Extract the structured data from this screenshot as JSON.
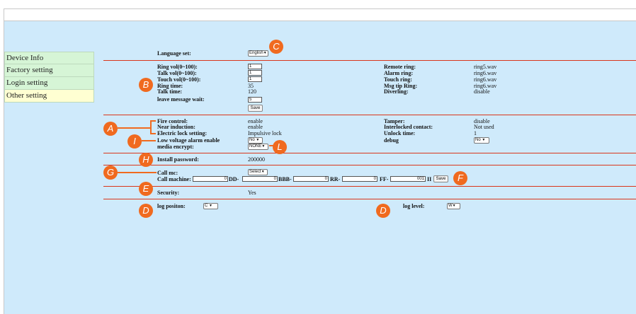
{
  "sidebar": {
    "items": [
      {
        "label": "Device Info"
      },
      {
        "label": "Factory setting"
      },
      {
        "label": "Login setting"
      },
      {
        "label": "Other setting"
      }
    ]
  },
  "language": {
    "label": "Language set:",
    "value": "English"
  },
  "ring": {
    "ring_vol_label": "Ring vol(0~100):",
    "ring_vol": "1",
    "talk_vol_label": "Talk vol(0~100):",
    "talk_vol": "1",
    "touch_vol_label": "Touch vol(0~100):",
    "touch_vol": "1",
    "ring_time_label": "Ring time:",
    "ring_time": "35",
    "talk_time_label": "Talk time:",
    "talk_time": "120",
    "leave_msg_label": "leave message wait:",
    "leave_msg": "5",
    "save_label": "Save",
    "remote_ring_label": "Remote ring:",
    "remote_ring": "ring5.wav",
    "alarm_ring_label": "Alarm ring:",
    "alarm_ring": "ring6.wav",
    "touch_ring_label": "Touch ring:",
    "touch_ring": "ring6.wav",
    "msg_tip_label": "Msg tip Ring:",
    "msg_tip": "ring6.wav",
    "diverling_label": "Diverling:",
    "diverling": "disable"
  },
  "control": {
    "fire_label": "Fire control:",
    "fire": "enable",
    "near_label": "Near induction:",
    "near": "enable",
    "lock_label": "Electric lock setting:",
    "lock": "Impulsive lock",
    "low_voltage_label": "Low voltage alarm enable",
    "low_voltage": "No",
    "encrypt_label": "media encrypt:",
    "encrypt": "NONE",
    "tamper_label": "Tamper:",
    "tamper": "disable",
    "interlocked_label": "Interlocked contact:",
    "interlocked": "Not used",
    "unlock_label": "Unlock time:",
    "unlock": "1",
    "debug_label": "debug",
    "debug": "No"
  },
  "install": {
    "label": "Install password:",
    "value": "200000"
  },
  "call": {
    "mc_label": "Call mc:",
    "mc_value": "Select",
    "machine_label": "Call machine:",
    "machine": "0",
    "dd_label": "DD-",
    "dd": "0",
    "bbb_label": "BBB-",
    "bbb": "0",
    "rr_label": "RR-",
    "rr": "0",
    "ff_label": "FF-",
    "ff": "001",
    "ii_label": "II",
    "save_label": "Save"
  },
  "security": {
    "label": "Security:",
    "value": "Yes"
  },
  "log": {
    "position_label": "log positon:",
    "position": "C",
    "level_label": "log level:",
    "level": "W"
  },
  "annotations": {
    "a": "A",
    "b": "B",
    "c": "C",
    "d": "D",
    "e": "E",
    "f": "F",
    "g": "G",
    "h": "H",
    "i": "I",
    "l": "L"
  },
  "colors": {
    "background": "#cfeafb",
    "divider": "#d9361a",
    "badge": "#f06a1f",
    "nav_green": "#d6f5d6",
    "nav_yellow": "#ffffd2"
  }
}
